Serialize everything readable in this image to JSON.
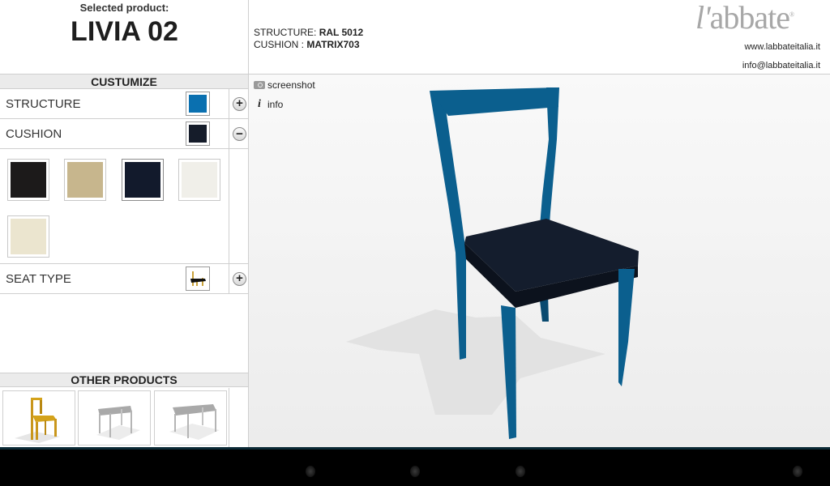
{
  "header": {
    "selected_label": "Selected product:",
    "product_name": "LIVIA 02",
    "structure_label": "STRUCTURE:",
    "structure_value": "RAL 5012",
    "cushion_label": "CUSHION :",
    "cushion_value": "MATRIX703",
    "logo_text": "abbate",
    "logo_prefix": "l'",
    "website": "www.labbateitalia.it",
    "email": "info@labbateitalia.it"
  },
  "customize": {
    "title": "CUSTUMIZE",
    "rows": [
      {
        "label": "STRUCTURE",
        "swatch_color": "#0a70b0",
        "toggle": "+",
        "expanded": false
      },
      {
        "label": "CUSHION",
        "swatch_color": "#151c2a",
        "toggle": "−",
        "expanded": true
      },
      {
        "label": "SEAT TYPE",
        "swatch_icon": "chair-seat-icon",
        "toggle": "+",
        "expanded": false
      }
    ],
    "cushion_options": [
      {
        "name": "black-fabric",
        "color": "#1c1a1a",
        "selected": false
      },
      {
        "name": "beige-fabric",
        "color": "#c7b68d",
        "selected": false
      },
      {
        "name": "navy-fabric",
        "color": "#121a2c",
        "selected": true
      },
      {
        "name": "white-fabric",
        "color": "#f0efe9",
        "selected": false
      },
      {
        "name": "cream-fabric",
        "color": "#ebe5cf",
        "selected": false
      }
    ]
  },
  "other_products": {
    "title": "OTHER PRODUCTS",
    "items": [
      {
        "name": "yellow-chair",
        "color": "#d4a21a"
      },
      {
        "name": "grey-table-square",
        "color": "#a9a9a9"
      },
      {
        "name": "grey-table-rect",
        "color": "#a9a9a9"
      }
    ]
  },
  "viewer": {
    "screenshot_label": "screenshot",
    "info_label": "info",
    "structure_color": "#0b5f8e",
    "cushion_color": "#141d2d"
  },
  "navbar": {
    "buttons": [
      "back",
      "home",
      "recent-apps",
      "menu"
    ]
  }
}
